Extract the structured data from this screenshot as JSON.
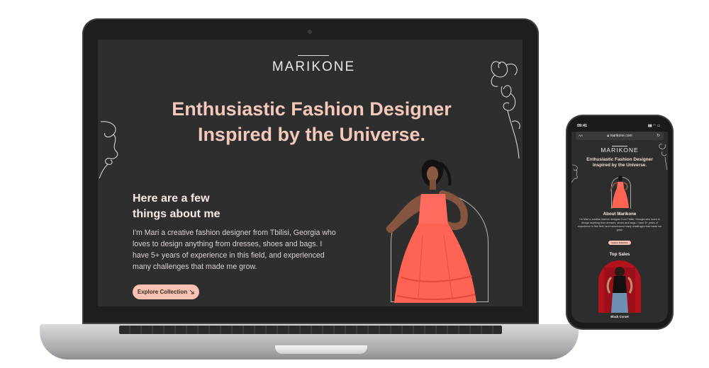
{
  "site": {
    "brand": "MARIKONE",
    "hero_line1": "Enthusiastic Fashion Designer",
    "hero_line2": "Inspired by the Universe.",
    "about_heading_line1": "Here are a few",
    "about_heading_line2": "things about me",
    "about_text": "I'm Mari a creative fashion designer from Tbilisi, Georgia who loves to design anything from dresses, shoes and bags. I have 5+ years of experience in this field, and experienced many challenges that made me grow.",
    "cta_label": "Explore Collection",
    "cta_icon": "arrow-icon"
  },
  "phone": {
    "status_time": "09:41",
    "aa_label": "AA",
    "url": "marikone.com",
    "brand": "MARIKONE",
    "hero_line1": "Enthusiastic Fashion Designer",
    "hero_line2": "Inspired by the Universe.",
    "about_heading": "About Marikone",
    "about_text": "I'm Mari a creative fashion designer from Tbilisi, Georgia who loves to design anything from dresses, shoes and bags. I have 5+ years of experience in this field, and experienced many challenges that made me grow.",
    "cta_label": "Explore Collection",
    "top_sales_heading": "Top Sales",
    "product_name": "Black Corset"
  },
  "colors": {
    "background_dark": "#2f2e2e",
    "accent_peach": "#f8c2b3",
    "hero_text": "#f3c9bb",
    "dress_coral": "#ff6b5e"
  }
}
